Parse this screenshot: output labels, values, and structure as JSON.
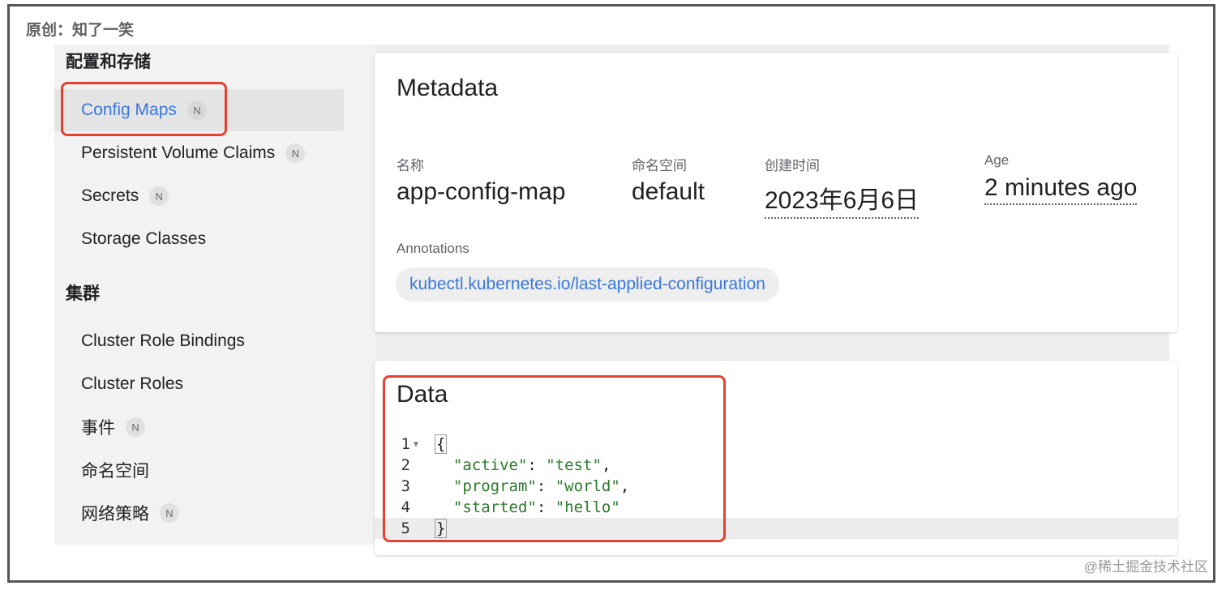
{
  "credit": "原创：知了一笑",
  "watermark": "@稀土掘金技术社区",
  "sidebar": {
    "section_config": "配置和存储",
    "config_items": [
      {
        "label": "Config Maps",
        "badge": "N"
      },
      {
        "label": "Persistent Volume Claims",
        "badge": "N"
      },
      {
        "label": "Secrets",
        "badge": "N"
      },
      {
        "label": "Storage Classes",
        "badge": ""
      }
    ],
    "section_cluster": "集群",
    "cluster_items": [
      {
        "label": "Cluster Role Bindings",
        "badge": ""
      },
      {
        "label": "Cluster Roles",
        "badge": ""
      },
      {
        "label": "事件",
        "badge": "N"
      },
      {
        "label": "命名空间",
        "badge": ""
      },
      {
        "label": "网络策略",
        "badge": "N"
      }
    ]
  },
  "metadata": {
    "title": "Metadata",
    "fields": [
      {
        "label": "名称",
        "value": "app-config-map"
      },
      {
        "label": "命名空间",
        "value": "default"
      },
      {
        "label": "创建时间",
        "value": "2023年6月6日"
      },
      {
        "label": "Age",
        "value": "2 minutes ago"
      }
    ],
    "annotations_label": "Annotations",
    "annotation_chip": "kubectl.kubernetes.io/last-applied-configuration"
  },
  "data_section": {
    "title": "Data",
    "lines": [
      {
        "num": "1",
        "open": "{"
      },
      {
        "num": "2",
        "key": "\"active\"",
        "val": "\"test\"",
        "tail": ","
      },
      {
        "num": "3",
        "key": "\"program\"",
        "val": "\"world\"",
        "tail": ","
      },
      {
        "num": "4",
        "key": "\"started\"",
        "val": "\"hello\"",
        "tail": ""
      },
      {
        "num": "5",
        "close": "}"
      }
    ]
  },
  "colors": {
    "link": "#3b78d8",
    "highlight": "#e8402e",
    "json_string": "#2a7a2a"
  }
}
